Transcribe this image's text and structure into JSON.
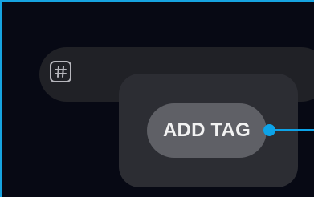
{
  "tag_bar": {
    "icon": "hash-icon"
  },
  "popup": {
    "button_label": "ADD TAG"
  },
  "colors": {
    "accent": "#0da3e8",
    "background": "#070914",
    "bar": "#202126",
    "card": "#2c2d33",
    "button": "#5f6066",
    "button_text": "#f2f2f2"
  }
}
